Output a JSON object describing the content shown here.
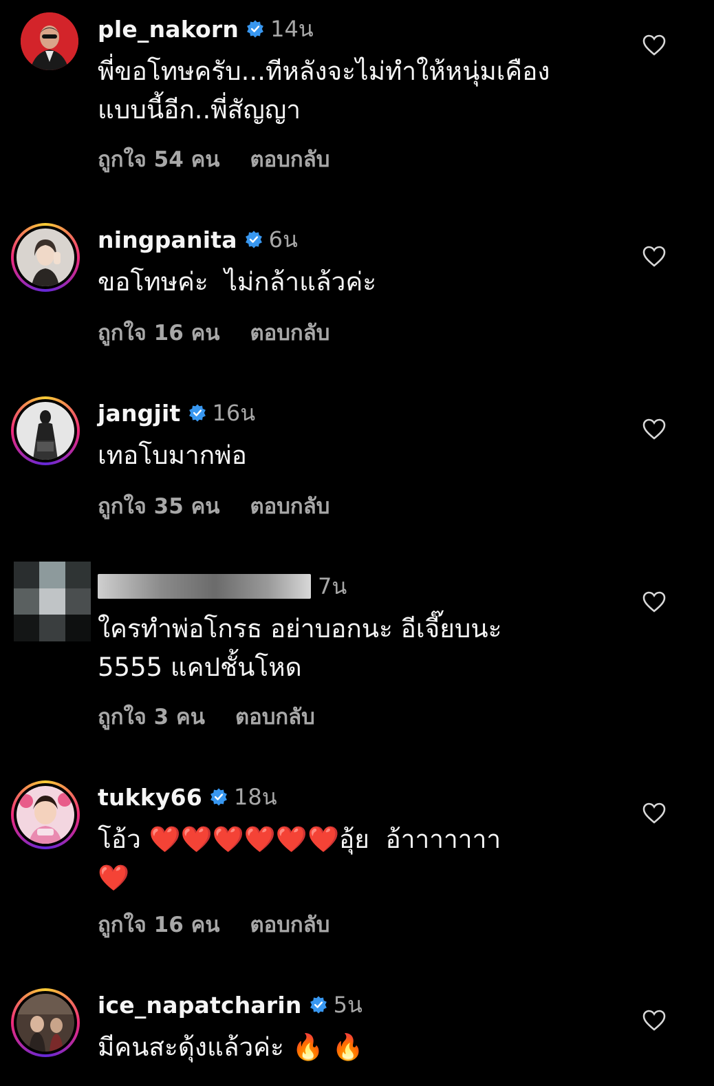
{
  "comments": [
    {
      "username": "ple_nakorn",
      "verified": true,
      "time": "14น",
      "lines": [
        "พี่ขอโทษครับ...ทีหลังจะไม่ทำให้หนุ่มเคือง",
        "แบบนี้อีก..พี่สัญญา"
      ],
      "likes": "ถูกใจ 54 คน",
      "reply": "ตอบกลับ",
      "avatar": "man-in-suit"
    },
    {
      "username": "ningpanita",
      "verified": true,
      "time": "6น",
      "lines": [
        "ขอโทษค่ะ  ไม่กล้าแล้วค่ะ"
      ],
      "likes": "ถูกใจ 16 คน",
      "reply": "ตอบกลับ",
      "avatar": "woman-portrait"
    },
    {
      "username": "jangjit",
      "verified": true,
      "time": "16น",
      "lines": [
        "เทอโบมากพ่อ"
      ],
      "likes": "ถูกใจ 35 คน",
      "reply": "ตอบกลับ",
      "avatar": "black-white-figure"
    },
    {
      "username": "",
      "verified": false,
      "time": "7น",
      "lines": [
        "ใครทำพ่อโกรธ อย่าบอกนะ อีเจี๊ยบนะ",
        "5555 แคปชั้นโหด"
      ],
      "likes": "ถูกใจ 3 คน",
      "reply": "ตอบกลับ",
      "avatar": "pixelated"
    },
    {
      "username": "tukky66",
      "verified": true,
      "time": "18น",
      "lines": [
        "โอ้ว ❤️❤️❤️❤️❤️❤️อุ้ย  อ้าาาาาาา",
        "❤️"
      ],
      "likes": "ถูกใจ 16 คน",
      "reply": "ตอบกลับ",
      "avatar": "woman-pink"
    },
    {
      "username": "ice_napatcharin",
      "verified": true,
      "time": "5น",
      "lines": [
        "มีคนสะดุ้งแล้วค่ะ 🔥 🔥"
      ],
      "likes": "",
      "reply": "",
      "avatar": "woman-scene"
    }
  ],
  "colors": {
    "background": "#000000",
    "text": "#f5f5f5",
    "secondary": "#a8a8a8",
    "verified": "#3897f0",
    "heart_emoji": "#e8242a"
  }
}
